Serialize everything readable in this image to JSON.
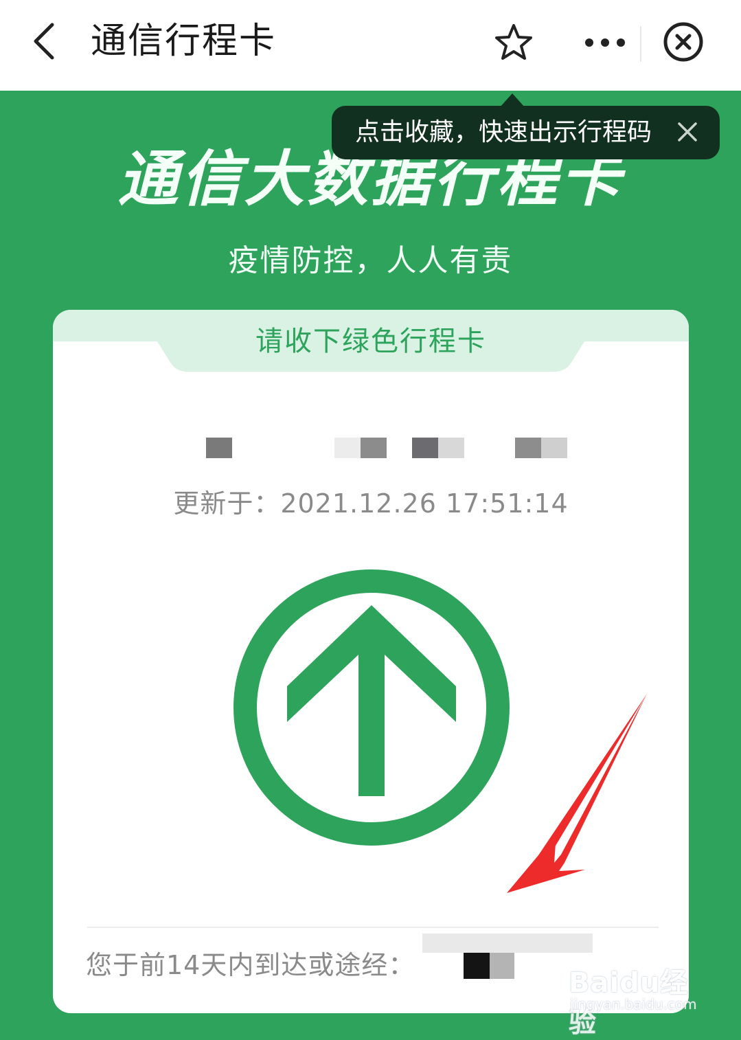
{
  "header": {
    "title": "通信行程卡"
  },
  "tooltip": {
    "text": "点击收藏，快速出示行程码"
  },
  "hero": {
    "title": "通信大数据行程卡",
    "subtitle": "疫情防控，人人有责"
  },
  "card": {
    "header_label": "请收下绿色行程卡",
    "update_time": "更新于：2021.12.26 17:51:14",
    "status": "green",
    "travel_label": "您于前14天内到达或途经："
  },
  "watermark": {
    "brand": "Baidu经验",
    "url": "jingyan.baidu.com"
  },
  "colors": {
    "brand_green": "#2ea35c",
    "tooltip_bg": "#12301f",
    "annotation_red": "#ee2b2b"
  },
  "icons": [
    "back-arrow-icon",
    "star-icon",
    "more-icon",
    "close-circle-icon",
    "close-icon",
    "up-arrow-circle-icon"
  ]
}
